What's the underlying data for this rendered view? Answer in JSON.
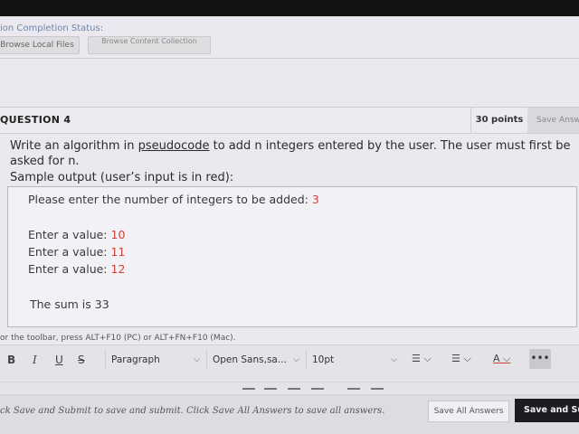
{
  "header": {
    "status_label": "ion Completion Status:",
    "browse_local": "Browse Local Files",
    "browse_content": "Browse Content Collection"
  },
  "question": {
    "title": "QUESTION 4",
    "points": "30 points",
    "save_answer": "Save Answer",
    "text_before": "Write an algorithm in ",
    "text_link": "pseudocode",
    "text_after": " to add n integers entered by the user. The user must first be asked for n.",
    "sample_label": "Sample output (user’s input is in red):"
  },
  "sample_output": {
    "prompt": "Please enter the number of integers to be added: ",
    "prompt_input": "3",
    "values": [
      {
        "label": "Enter a value: ",
        "input": "10"
      },
      {
        "label": "Enter a value: ",
        "input": "11"
      },
      {
        "label": "Enter a value: ",
        "input": "12"
      }
    ],
    "sum": "The sum is 33"
  },
  "toolbar": {
    "hint": "or the toolbar, press ALT+F10 (PC) or ALT+FN+F10 (Mac).",
    "bold": "B",
    "italic": "I",
    "underline": "U",
    "strike": "S",
    "paragraph": "Paragraph",
    "font": "Open Sans,sa...",
    "size": "10pt",
    "more": "•••"
  },
  "footer": {
    "instruction": "ck Save and Submit to save and submit. Click Save All Answers to save all answers.",
    "save_all": "Save All Answers",
    "save_submit": "Save and Submit"
  },
  "colors": {
    "input_red": "#d2403a",
    "submit_bg": "#1d1c20"
  }
}
